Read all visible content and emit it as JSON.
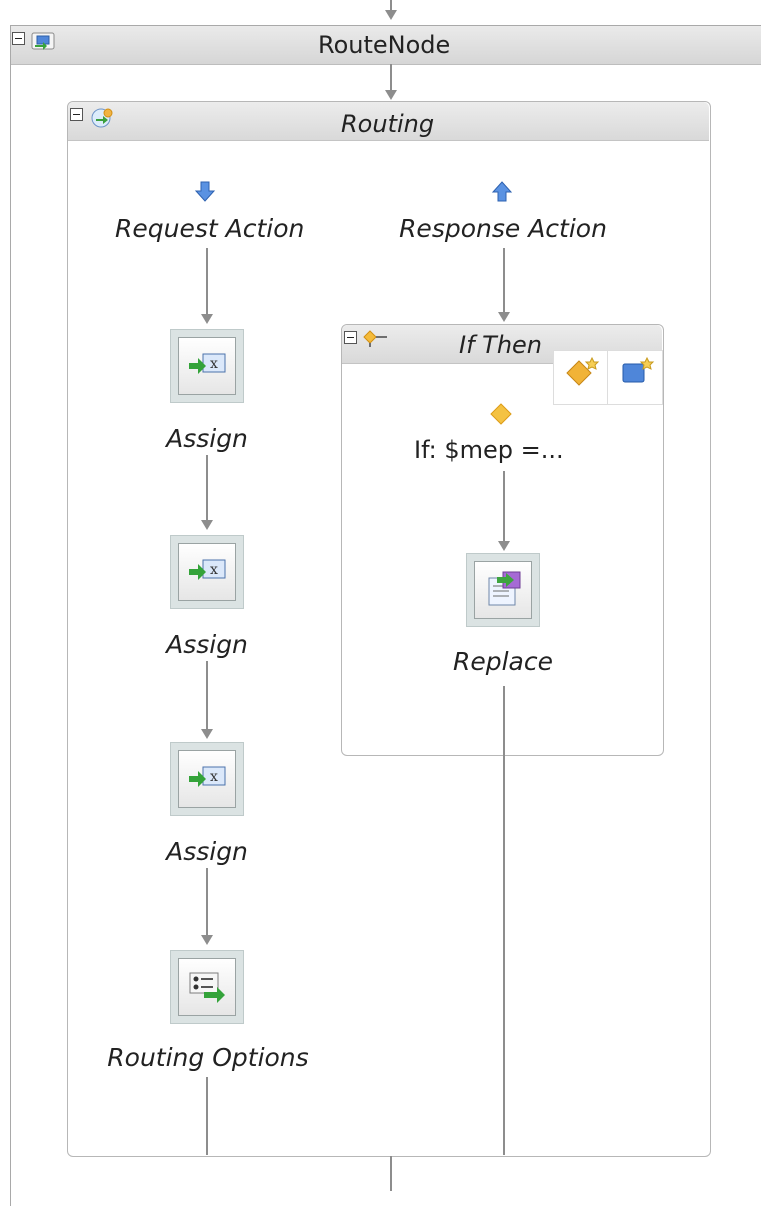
{
  "route_node": {
    "title": "RouteNode"
  },
  "routing": {
    "title": "Routing"
  },
  "request_action": {
    "label": "Request Action"
  },
  "response_action": {
    "label": "Response Action"
  },
  "assign_nodes": [
    {
      "label": "Assign"
    },
    {
      "label": "Assign"
    },
    {
      "label": "Assign"
    }
  ],
  "routing_options": {
    "label": "Routing Options"
  },
  "if_then": {
    "title": "If Then",
    "condition": "If: $mep =..."
  },
  "replace": {
    "label": "Replace"
  },
  "colors": {
    "line": "#8d8d8d",
    "accent_blue": "#4a7fd8",
    "diamond": "#f3b43c"
  }
}
